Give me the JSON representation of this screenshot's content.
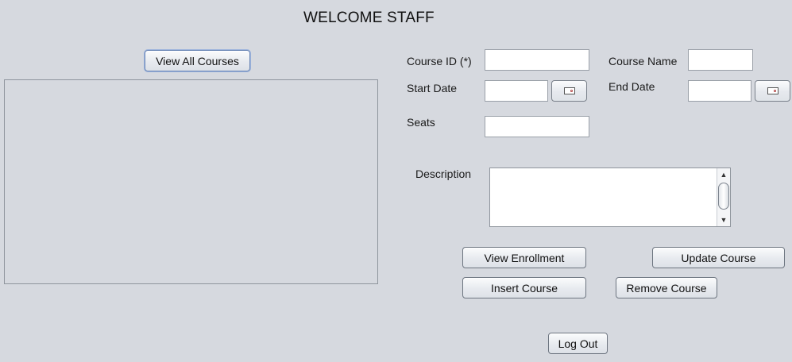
{
  "header": {
    "title": "WELCOME STAFF"
  },
  "courses_panel": {
    "view_all_label": "View All Courses"
  },
  "form": {
    "course_id_label": "Course ID (*)",
    "course_id_value": "",
    "course_name_label": "Course Name",
    "course_name_value": "",
    "start_date_label": "Start Date",
    "start_date_value": "",
    "end_date_label": "End Date",
    "end_date_value": "",
    "seats_label": "Seats",
    "seats_value": "",
    "description_label": "Description",
    "description_value": "",
    "calendar_icon": "calendar-icon"
  },
  "actions": {
    "view_enrollment_label": "View Enrollment",
    "update_course_label": "Update Course",
    "insert_course_label": "Insert Course",
    "remove_course_label": "Remove Course",
    "log_out_label": "Log Out"
  },
  "scrollbar": {
    "up_glyph": "▲",
    "down_glyph": "▼"
  }
}
